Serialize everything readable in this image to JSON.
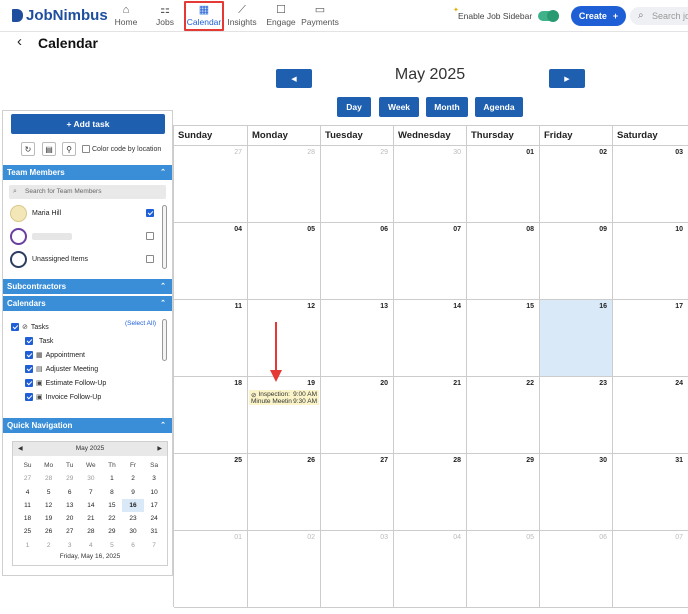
{
  "brand": {
    "name": "JobNimbus"
  },
  "nav": [
    {
      "label": "Home",
      "icon": "home-icon",
      "glyph": "⌂"
    },
    {
      "label": "Jobs",
      "icon": "jobs-icon",
      "glyph": "⚏"
    },
    {
      "label": "Calendar",
      "icon": "calendar-icon",
      "glyph": "▦",
      "active": true
    },
    {
      "label": "Insights",
      "icon": "insights-icon",
      "glyph": "⟋"
    },
    {
      "label": "Engage",
      "icon": "engage-icon",
      "glyph": "☐"
    },
    {
      "label": "Payments",
      "icon": "payments-icon",
      "glyph": "▭"
    }
  ],
  "header": {
    "sidebar_toggle_label": "Enable Job Sidebar",
    "create_label": "Create",
    "search_placeholder": "Search jobs"
  },
  "page": {
    "title": "Calendar"
  },
  "calendar": {
    "month_title": "May 2025",
    "views": [
      "Day",
      "Week",
      "Month",
      "Agenda"
    ],
    "weekdays": [
      "Sunday",
      "Monday",
      "Tuesday",
      "Wednesday",
      "Thursday",
      "Friday",
      "Saturday"
    ],
    "weeks": [
      [
        "27",
        "28",
        "29",
        "30",
        "01",
        "02",
        "03"
      ],
      [
        "04",
        "05",
        "06",
        "07",
        "08",
        "09",
        "10"
      ],
      [
        "11",
        "12",
        "13",
        "14",
        "15",
        "16",
        "17"
      ],
      [
        "18",
        "19",
        "20",
        "21",
        "22",
        "23",
        "24"
      ],
      [
        "25",
        "26",
        "27",
        "28",
        "29",
        "30",
        "31"
      ],
      [
        "01",
        "02",
        "03",
        "04",
        "05",
        "06",
        "07"
      ]
    ],
    "event": {
      "title1": "Inspection:",
      "time1": "9:00 AM",
      "title2": "Minute Meetin",
      "time2": "9:30 AM"
    }
  },
  "sidebar": {
    "add_task_label": "+ Add task",
    "color_code_label": "Color code by location",
    "team_members_header": "Team Members",
    "team_search_placeholder": "Search for Team Members",
    "members": [
      {
        "name": "Maria Hill",
        "checked": true
      },
      {
        "name": "",
        "checked": false
      },
      {
        "name": "Unassigned Items",
        "checked": false
      }
    ],
    "subcontractors_header": "Subcontractors",
    "calendars_header": "Calendars",
    "select_all_label": "(Select All)",
    "tasks_label": "Tasks",
    "calendar_items": [
      {
        "label": "Task",
        "glyph": ""
      },
      {
        "label": "Appointment",
        "glyph": "▦"
      },
      {
        "label": "Adjuster Meeting",
        "glyph": "▤"
      },
      {
        "label": "Estimate Follow-Up",
        "glyph": "▣"
      },
      {
        "label": "Invoice Follow-Up",
        "glyph": "▣"
      }
    ],
    "quick_nav_header": "Quick Navigation",
    "mini_cal": {
      "title": "May 2025",
      "weekdays": [
        "Su",
        "Mo",
        "Tu",
        "We",
        "Th",
        "Fr",
        "Sa"
      ],
      "weeks": [
        [
          "27",
          "28",
          "29",
          "30",
          "1",
          "2",
          "3"
        ],
        [
          "4",
          "5",
          "6",
          "7",
          "8",
          "9",
          "10"
        ],
        [
          "11",
          "12",
          "13",
          "14",
          "15",
          "16",
          "17"
        ],
        [
          "18",
          "19",
          "20",
          "21",
          "22",
          "23",
          "24"
        ],
        [
          "25",
          "26",
          "27",
          "28",
          "29",
          "30",
          "31"
        ],
        [
          "1",
          "2",
          "3",
          "4",
          "5",
          "6",
          "7"
        ]
      ],
      "footer": "Friday, May 16, 2025"
    }
  },
  "colors": {
    "accent": "#1f5fb0",
    "header": "#3a8ed8",
    "today": "#d9e9f8",
    "highlight": "#e53935"
  }
}
